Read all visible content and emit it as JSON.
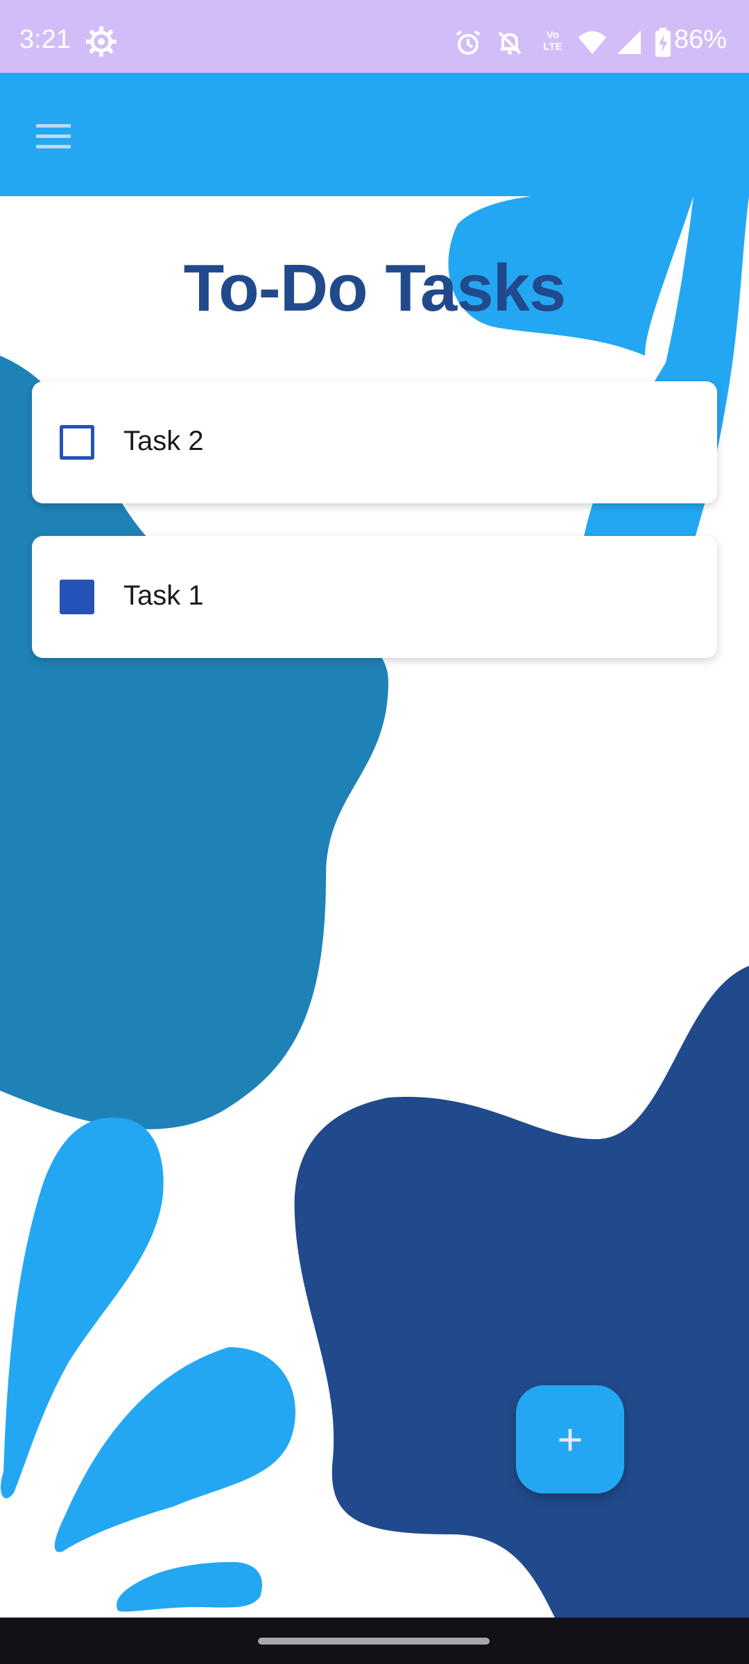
{
  "status_bar": {
    "time": "3:21",
    "battery": "86%",
    "icons": [
      "settings-gear-icon",
      "alarm-icon",
      "notifications-off-icon",
      "volte-icon",
      "wifi-icon",
      "signal-icon",
      "battery-charging-icon"
    ],
    "volte_line1": "Vo",
    "volte_line2": "LTE"
  },
  "app_bar": {
    "menu_icon": "hamburger-menu-icon"
  },
  "page": {
    "title": "To-Do Tasks"
  },
  "tasks": [
    {
      "label": "Task 2",
      "checked": false
    },
    {
      "label": "Task 1",
      "checked": true
    }
  ],
  "fab": {
    "label": "+"
  },
  "colors": {
    "status_bar": "#d2bdf9",
    "app_bar": "#24a7f2",
    "title": "#214a8c",
    "checkbox": "#2552b6",
    "shape_light": "#24a7f2",
    "shape_mid": "#1f82b7",
    "shape_dark": "#214a8c"
  }
}
